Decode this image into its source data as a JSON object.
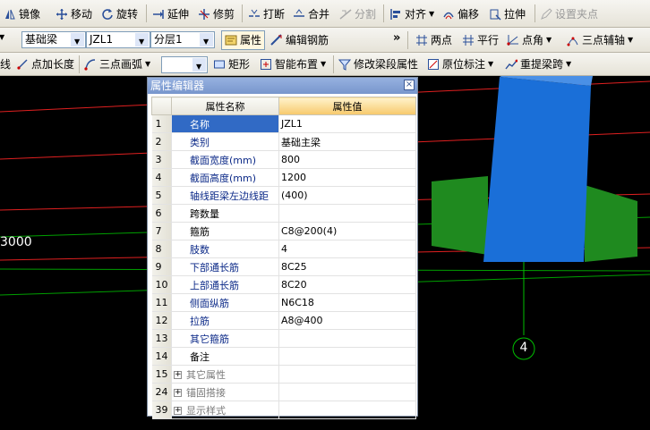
{
  "toolbar1": {
    "mirror": "镜像",
    "move": "移动",
    "rotate": "旋转",
    "extend": "延伸",
    "trim": "修剪",
    "break": "打断",
    "merge": "合并",
    "split": "分割",
    "align": "对齐",
    "offset": "偏移",
    "stretch": "拉伸",
    "set_pinch": "设置夹点"
  },
  "toolbar2": {
    "category": "基础梁",
    "name": "JZL1",
    "layer": "分层1",
    "properties": "属性",
    "edit_rebar": "编辑钢筋",
    "more": "»",
    "two_points": "两点",
    "parallel": "平行",
    "point_angle": "点角",
    "three_point_aux": "三点辅轴"
  },
  "toolbar3": {
    "line_cut": "线",
    "point_length": "点加长度",
    "three_point_arc": "三点画弧",
    "rect": "矩形",
    "smart_layout": "智能布置",
    "modify_span": "修改梁段属性",
    "in_place": "原位标注",
    "re_extract": "重提梁跨"
  },
  "canvas": {
    "dim_label": "3000",
    "axis_label": "4"
  },
  "dialog": {
    "title": "属性编辑器",
    "close": "×",
    "col_name": "属性名称",
    "col_value": "属性值",
    "rows": [
      {
        "no": "1",
        "name": "名称",
        "value": "JZL1"
      },
      {
        "no": "2",
        "name": "类别",
        "value": "基础主梁"
      },
      {
        "no": "3",
        "name": "截面宽度(mm)",
        "value": "800"
      },
      {
        "no": "4",
        "name": "截面高度(mm)",
        "value": "1200"
      },
      {
        "no": "5",
        "name": "轴线距梁左边线距",
        "value": "(400)"
      },
      {
        "no": "6",
        "name": "跨数量",
        "value": ""
      },
      {
        "no": "7",
        "name": "箍筋",
        "value": "C8@200(4)"
      },
      {
        "no": "8",
        "name": "肢数",
        "value": "4"
      },
      {
        "no": "9",
        "name": "下部通长筋",
        "value": "8C25"
      },
      {
        "no": "10",
        "name": "上部通长筋",
        "value": "8C20"
      },
      {
        "no": "11",
        "name": "侧面纵筋",
        "value": "N6C18"
      },
      {
        "no": "12",
        "name": "拉筋",
        "value": "A8@400"
      },
      {
        "no": "13",
        "name": "其它箍筋",
        "value": ""
      },
      {
        "no": "14",
        "name": "备注",
        "value": ""
      }
    ],
    "groups": [
      {
        "no": "15",
        "name": "其它属性"
      },
      {
        "no": "24",
        "name": "锚固搭接"
      },
      {
        "no": "39",
        "name": "显示样式"
      }
    ]
  }
}
